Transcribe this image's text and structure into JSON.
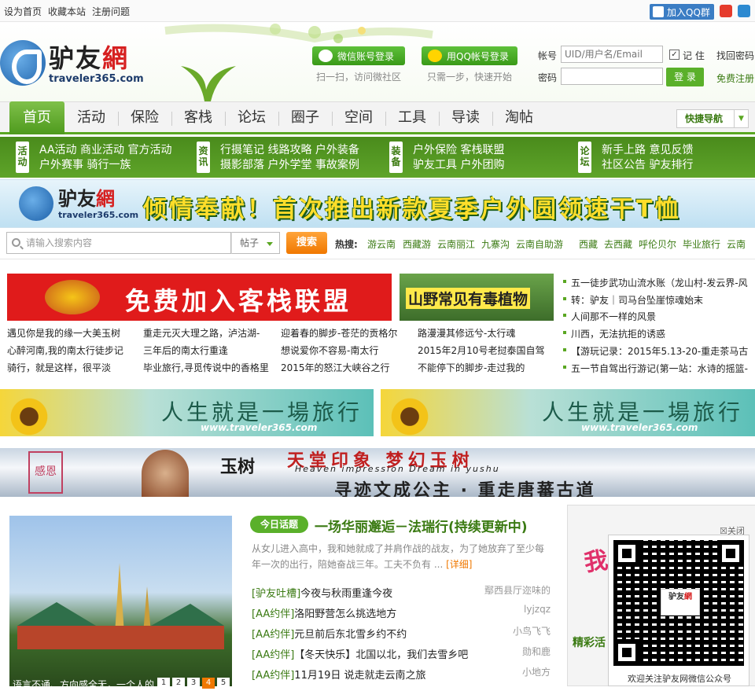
{
  "topbar": {
    "links": [
      "设为首页",
      "收藏本站",
      "注册问题"
    ],
    "qq_group": "加入QQ群"
  },
  "logo": {
    "cn1": "驴友",
    "cn2": "網",
    "en": "traveler365.com"
  },
  "social": {
    "wechat_label": "微信账号登录",
    "wechat_sub": "扫一扫，访问微社区",
    "qq_label": "用QQ帐号登录",
    "qq_sub": "只需一步，快速开始"
  },
  "login": {
    "account_label": "帐号",
    "account_placeholder": "UID/用户名/Email",
    "remember": "记 住",
    "find_pwd": "找回密码",
    "password_label": "密码",
    "submit": "登 录",
    "register": "免费注册"
  },
  "nav": {
    "items": [
      "首页",
      "活动",
      "保险",
      "客栈",
      "论坛",
      "圈子",
      "空间",
      "工具",
      "导读",
      "淘帖"
    ],
    "quick": "快捷导航"
  },
  "subnav": [
    {
      "cat": "活动",
      "links": [
        [
          "AA活动",
          "商业活动",
          "官方活动"
        ],
        [
          "户外赛事",
          "骑行一族"
        ]
      ]
    },
    {
      "cat": "资讯",
      "links": [
        [
          "行摄笔记",
          "线路攻略",
          "户外装备"
        ],
        [
          "摄影部落",
          "户外学堂",
          "事故案例"
        ]
      ]
    },
    {
      "cat": "装备",
      "links": [
        [
          "户外保险",
          "客栈联盟"
        ],
        [
          "驴友工具",
          "户外团购"
        ]
      ]
    },
    {
      "cat": "论坛",
      "links": [
        [
          "新手上路",
          "意见反馈"
        ],
        [
          "社区公告",
          "驴友排行"
        ]
      ]
    }
  ],
  "banner1": {
    "text": "倾情奉献！首次推出新款夏季户外圆领速干T恤"
  },
  "search": {
    "placeholder": "请输入搜索内容",
    "type": "帖子",
    "button": "搜索",
    "hot_label": "热搜:",
    "hot_words": [
      "游云南",
      "西藏游",
      "云南丽江",
      "九寨沟",
      "云南自助游",
      "西藏",
      "去西藏",
      "呼伦贝尔",
      "毕业旅行",
      "云南"
    ]
  },
  "ads": {
    "inn": "免费加入客栈联盟",
    "plants": "山野常见有毒植物",
    "travel": "人生就是一場旅行",
    "travel_url": "www.traveler365.com",
    "yushu1": "玉树",
    "yushu2": "天堂印象 梦幻玉树",
    "yushu3": "Heaven impression Dream in yushu",
    "yushu4": "寻迹文成公主 · 重走唐蕃古道",
    "seal": "感恩"
  },
  "news_cols": [
    [
      "遇见你是我的缘一大美玉树",
      "心醉河南,我的南太行徒步记",
      "骑行，就是这样，很平淡"
    ],
    [
      "重走元灭大理之路，泸沽湖-",
      "三年后的南太行重逢",
      "毕业旅行,寻觅传说中的香格里"
    ],
    [
      "迎着春的脚步-苍茫的贡格尔",
      "想说爱你不容易-南太行",
      "2015年的怒江大峡谷之行"
    ],
    [
      "路漫漫其修远兮-太行魂",
      "2015年2月10号老挝泰国自驾",
      "不能停下的脚步-走过我的"
    ]
  ],
  "right_list": [
    "五一徒步武功山流水账（龙山村-发云界-风",
    "转：驴友｜司马台坠崖惊魂始末",
    "人间那不一样的风景",
    "川西，无法抗拒的诱惑",
    "【游玩记录：2015年5.13-20-重走茶马古",
    "五一节自驾出行游记(第一站：水诗的摇篮-"
  ],
  "feature": {
    "badge": "今日话题",
    "headline": "一场华丽邂逅－法瑞行(持续更新中)",
    "summary": "从女儿进入高中，我和她就成了并肩作战的战友，为了她放弃了至少每年一次的出行，陪她奋战三年。工夫不负有",
    "more": "[详细]",
    "photo_caption": "语言不通、方向感全无，一个人的",
    "pages": [
      "1",
      "2",
      "3",
      "4",
      "5"
    ]
  },
  "forum": [
    {
      "tag": "[驴友吐槽]",
      "title": "今夜与秋雨重逢今夜",
      "user": "鄢西县厅迩味的"
    },
    {
      "tag": "[AA约伴]",
      "title": "洛阳野营怎么挑选地方",
      "user": "lyjzqz"
    },
    {
      "tag": "[AA约伴]",
      "title": "元旦前后东北雪乡约不约",
      "user": "小鸟飞飞"
    },
    {
      "tag": "[AA约伴]",
      "title": "【冬天快乐】北国以北，我们去雪乡吧",
      "user": "勋和鹿"
    },
    {
      "tag": "[AA约伴]",
      "title": "11月19日 说走就走云南之旅",
      "user": "小地方"
    }
  ],
  "qr": {
    "close": "关闭",
    "caption": "欢迎关注驴友网微信公众号",
    "right_ad": "我为地狱",
    "right_title": "精彩活"
  }
}
